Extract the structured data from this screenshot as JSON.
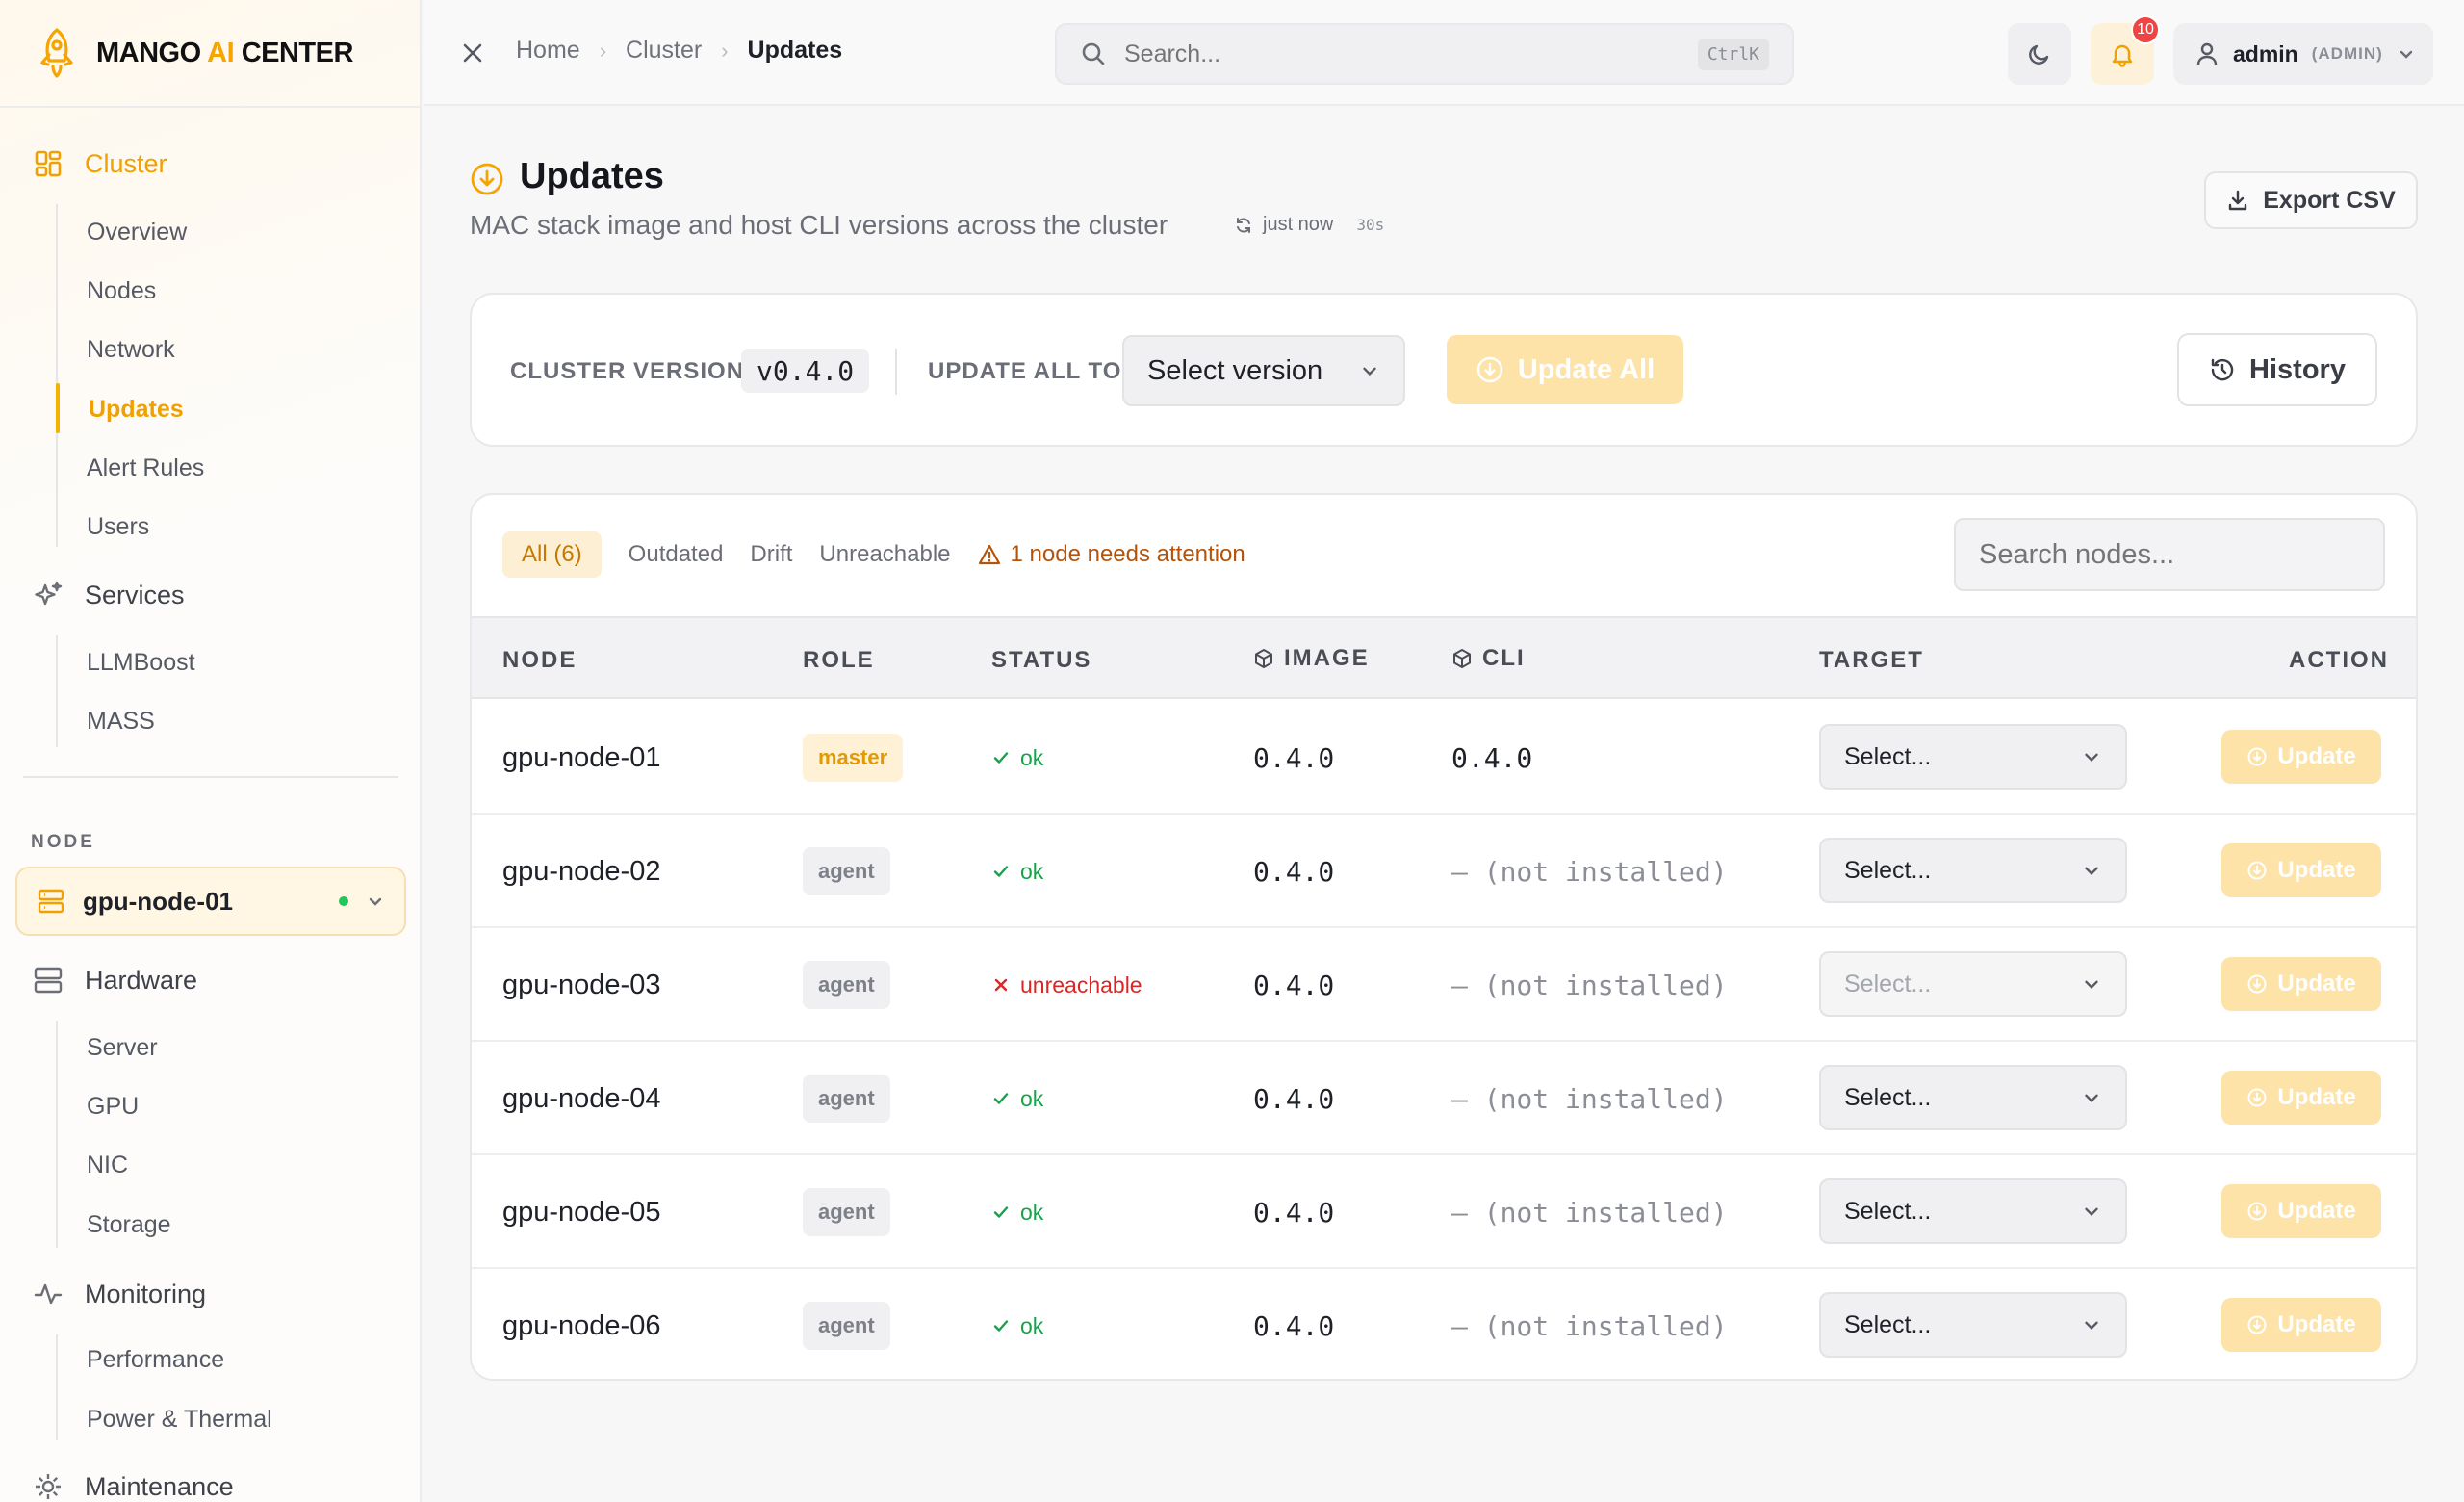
{
  "brand": {
    "name_a": "MANGO ",
    "name_b": "AI",
    "name_c": " CENTER",
    "accent": "#f6a500"
  },
  "sidebar": {
    "groups": [
      {
        "label": "Cluster",
        "icon": "grid-icon",
        "items": [
          "Overview",
          "Nodes",
          "Network",
          "Updates",
          "Alert Rules",
          "Users"
        ],
        "active_item": "Updates"
      },
      {
        "label": "Services",
        "icon": "sparkles-icon",
        "items": [
          "LLMBoost",
          "MASS"
        ]
      },
      {
        "label": "Hardware",
        "icon": "server-icon",
        "items": [
          "Server",
          "GPU",
          "NIC",
          "Storage"
        ]
      },
      {
        "label": "Monitoring",
        "icon": "activity-icon",
        "items": [
          "Performance",
          "Power & Thermal"
        ]
      },
      {
        "label": "Maintenance",
        "icon": "gear-icon",
        "items": []
      }
    ],
    "node_section_label": "NODE",
    "node_selected": "gpu-node-01",
    "node_status_color": "#22c55e"
  },
  "topbar": {
    "breadcrumbs": [
      "Home",
      "Cluster",
      "Updates"
    ],
    "search_placeholder": "Search...",
    "search_shortcut": "CtrlK",
    "notification_count": "10",
    "user_name": "admin",
    "user_role": "(ADMIN)"
  },
  "page": {
    "title": "Updates",
    "subtitle": "MAC stack image and host CLI versions across the cluster",
    "refresh_text": "just now",
    "refresh_interval": "30s",
    "export_label": "Export CSV"
  },
  "version_panel": {
    "cluster_version_label": "CLUSTER VERSION",
    "cluster_version": "v0.4.0",
    "update_all_label": "UPDATE ALL TO",
    "select_version_placeholder": "Select version",
    "update_all_button": "Update All",
    "history_button": "History"
  },
  "filters": {
    "tabs": [
      "All (6)",
      "Outdated",
      "Drift",
      "Unreachable"
    ],
    "active_tab": "All (6)",
    "attention_text": "1 node needs attention",
    "search_placeholder": "Search nodes..."
  },
  "table": {
    "columns": [
      "NODE",
      "ROLE",
      "STATUS",
      "IMAGE",
      "CLI",
      "TARGET",
      "ACTION"
    ],
    "rows": [
      {
        "node": "gpu-node-01",
        "role": "master",
        "status": "ok",
        "image": "0.4.0",
        "cli": "0.4.0",
        "target": "Select...",
        "action": "Update"
      },
      {
        "node": "gpu-node-02",
        "role": "agent",
        "status": "ok",
        "image": "0.4.0",
        "cli": "— (not installed)",
        "target": "Select...",
        "action": "Update"
      },
      {
        "node": "gpu-node-03",
        "role": "agent",
        "status": "unreachable",
        "image": "0.4.0",
        "cli": "— (not installed)",
        "target": "Select...",
        "action": "Update"
      },
      {
        "node": "gpu-node-04",
        "role": "agent",
        "status": "ok",
        "image": "0.4.0",
        "cli": "— (not installed)",
        "target": "Select...",
        "action": "Update"
      },
      {
        "node": "gpu-node-05",
        "role": "agent",
        "status": "ok",
        "image": "0.4.0",
        "cli": "— (not installed)",
        "target": "Select...",
        "action": "Update"
      },
      {
        "node": "gpu-node-06",
        "role": "agent",
        "status": "ok",
        "image": "0.4.0",
        "cli": "— (not installed)",
        "target": "Select...",
        "action": "Update"
      }
    ]
  },
  "colors": {
    "ok": "#16a34a",
    "error": "#dc2626",
    "accent": "#f6b100",
    "warning": "#b45309"
  }
}
